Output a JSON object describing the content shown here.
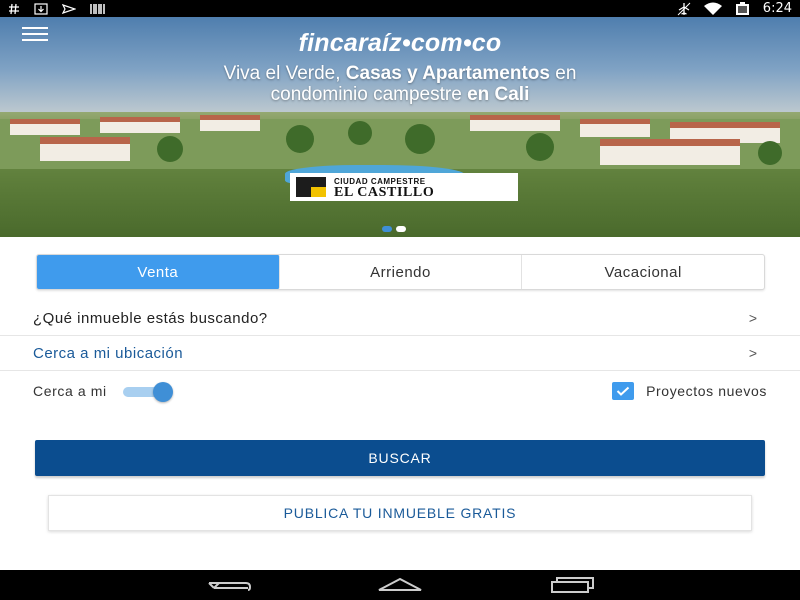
{
  "status_bar": {
    "time": "6:24",
    "left_icons": [
      "hashtag-icon",
      "download-icon",
      "send-icon",
      "barcode-icon"
    ],
    "right_icons": [
      "airplane-icon",
      "wifi-icon",
      "battery-icon"
    ],
    "background": "#000000"
  },
  "hero": {
    "brand": "fincaraíz•com•co",
    "headline": {
      "line1_a": "Viva el Verde, ",
      "line1_b": "Casas y Apartamentos",
      "line1_c": " en",
      "line2_a": "condominio campestre ",
      "line2_b": "en Cali"
    },
    "sponsor": {
      "small": "Ciudad Campestre",
      "big": "EL CASTILLO"
    },
    "carousel": {
      "total": 2,
      "active": 0
    }
  },
  "tabs": [
    {
      "label": "Venta",
      "active": true
    },
    {
      "label": "Arriendo",
      "active": false
    },
    {
      "label": "Vacacional",
      "active": false
    }
  ],
  "rows": {
    "property_type": {
      "label": "¿Qué inmueble estás buscando?",
      "chevron": ">"
    },
    "location": {
      "label": "Cerca a mi ubicación",
      "chevron": ">"
    }
  },
  "options": {
    "near_me_label": "Cerca a mi",
    "near_me_on": true,
    "new_projects_label": "Proyectos nuevos",
    "new_projects_checked": true
  },
  "buttons": {
    "search": "BUSCAR",
    "publish": "PUBLICA TU INMUEBLE GRATIS"
  },
  "colors": {
    "accent": "#3f9bed",
    "primary_dark": "#0b4d8f",
    "link": "#1a5a99"
  }
}
